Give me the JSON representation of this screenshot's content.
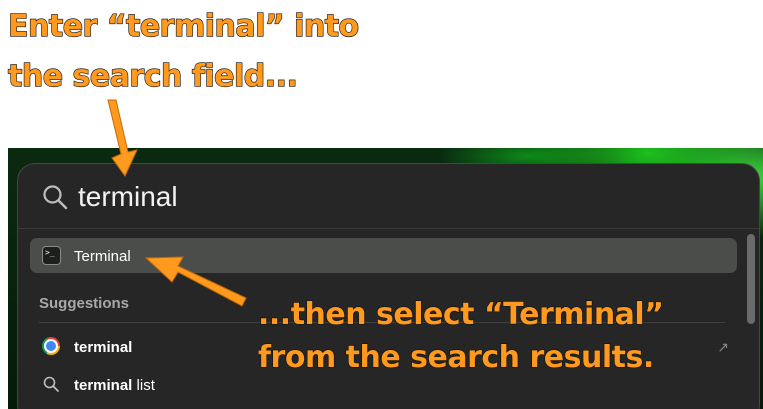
{
  "annotations": {
    "top_line1": "Enter “terminal” into",
    "top_line2": "the search field...",
    "bottom_line1": "...then select “Terminal”",
    "bottom_line2": "from the search results."
  },
  "spotlight": {
    "query": "terminal",
    "top_hit": {
      "label": "Terminal",
      "icon": "terminal-app-icon"
    },
    "section_label": "Suggestions",
    "suggestions": [
      {
        "icon": "chrome-icon",
        "bold": "terminal",
        "rest": "",
        "action_icon": "external-arrow-icon",
        "action_glyph": "↗"
      },
      {
        "icon": "search-icon",
        "bold": "terminal",
        "rest": " list"
      }
    ]
  },
  "colors": {
    "annotation": "#ff9a1f",
    "panel_bg": "#262626",
    "selected_row": "#4a4d4a"
  }
}
